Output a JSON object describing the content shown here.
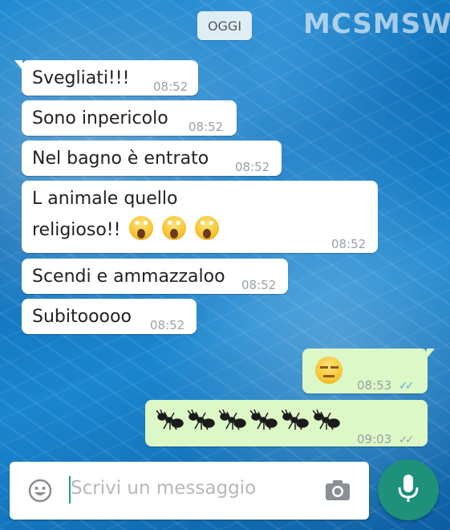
{
  "header": {
    "date_label": "OGGI",
    "watermark": "MCSMSW"
  },
  "messages": [
    {
      "text": "Svegliati!!!",
      "time": "08:52",
      "direction": "incoming"
    },
    {
      "text": "Sono inpericolo",
      "time": "08:52",
      "direction": "incoming"
    },
    {
      "text": "Nel bagno è entrato",
      "time": "08:52",
      "direction": "incoming"
    },
    {
      "text_line1": "L animale quello",
      "text_line2": "religioso!!",
      "emoji": "face-screaming-in-fear x3",
      "time": "08:52",
      "direction": "incoming"
    },
    {
      "text": "Scendi e ammazzaloo",
      "time": "08:52",
      "direction": "incoming"
    },
    {
      "text": "Subitooooo",
      "time": "08:52",
      "direction": "incoming"
    },
    {
      "emoji": "expressionless-face",
      "time": "08:53",
      "status": "read",
      "direction": "outgoing"
    },
    {
      "emoji": "ant x6",
      "time": "09:03",
      "status": "delivered",
      "direction": "outgoing"
    }
  ],
  "composer": {
    "placeholder": "Scrivi un messaggio",
    "emoji_icon": "smiley-icon",
    "camera_icon": "camera-icon",
    "mic_icon": "mic-icon"
  },
  "colors": {
    "incoming_bubble": "#ffffff",
    "outgoing_bubble": "#dcf8c6",
    "read_tick": "#4fb3e8",
    "mic_button": "#1f9079"
  }
}
